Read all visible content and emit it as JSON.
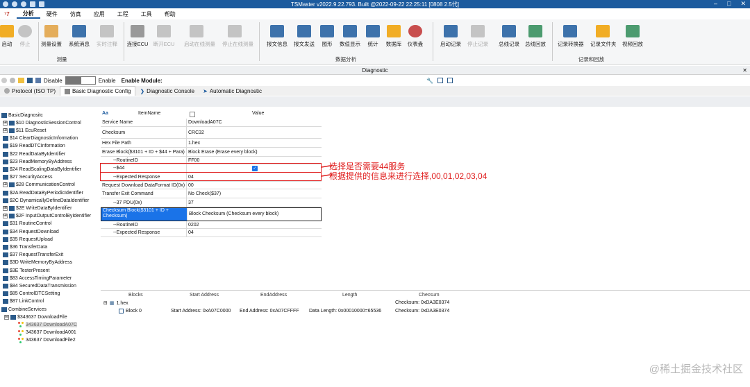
{
  "window": {
    "title": "TSMaster v2022.9.22.793. Built @2022-09-22 22:25:11 [0808 2.5代]"
  },
  "menu": {
    "items": [
      "分析",
      "硬件",
      "仿真",
      "应用",
      "工程",
      "工具",
      "帮助"
    ],
    "active": 0
  },
  "ribbon": {
    "buttons": [
      {
        "label": "启动",
        "icon": "lightning-icon",
        "color": "#f0a000",
        "dis": false
      },
      {
        "label": "停止",
        "icon": "stop-circle-icon",
        "color": "#bbb",
        "dis": true
      },
      {
        "label": "测量设置",
        "icon": "tree-settings-icon",
        "color": "#e0a040",
        "dis": false
      },
      {
        "label": "系统消息",
        "icon": "chat-icon",
        "color": "#1c5b9e",
        "dis": false
      },
      {
        "label": "实时注释",
        "icon": "comment-icon",
        "color": "#bbb",
        "dis": true
      },
      {
        "label": "连接ECU",
        "icon": "link-icon",
        "color": "#888",
        "dis": false
      },
      {
        "label": "断开ECU",
        "icon": "unlink-icon",
        "color": "#bbb",
        "dis": true
      },
      {
        "label": "启动在线测量",
        "icon": "play-icon",
        "color": "#bbb",
        "dis": true
      },
      {
        "label": "停止在线测量",
        "icon": "stop-square-icon",
        "color": "#bbb",
        "dis": true
      },
      {
        "label": "报文信息",
        "icon": "list-icon",
        "color": "#1c5b9e",
        "dis": false
      },
      {
        "label": "报文发送",
        "icon": "mail-icon",
        "color": "#1c5b9e",
        "dis": false
      },
      {
        "label": "图形",
        "icon": "line-graph-icon",
        "color": "#1c5b9e",
        "dis": false
      },
      {
        "label": "数值显示",
        "icon": "number-12-icon",
        "color": "#1c5b9e",
        "dis": false
      },
      {
        "label": "统计",
        "icon": "bar-stats-icon",
        "color": "#1c5b9e",
        "dis": false
      },
      {
        "label": "数据库",
        "icon": "database-icon",
        "color": "#f0a000",
        "dis": false
      },
      {
        "label": "仪表盘",
        "icon": "gauge-icon",
        "color": "#c03030",
        "dis": false
      },
      {
        "label": "启动记录",
        "icon": "record-play-icon",
        "color": "#1c5b9e",
        "dis": false
      },
      {
        "label": "停止记录",
        "icon": "record-stop-icon",
        "color": "#bbb",
        "dis": true
      },
      {
        "label": "总线记录",
        "icon": "bus-record-icon",
        "color": "#1c5b9e",
        "dis": false
      },
      {
        "label": "总线回放",
        "icon": "bus-replay-icon",
        "color": "#2e8b57",
        "dis": false
      },
      {
        "label": "记录转换器",
        "icon": "converter-icon",
        "color": "#1c5b9e",
        "dis": false
      },
      {
        "label": "记录文件夹",
        "icon": "folder-icon",
        "color": "#f0a000",
        "dis": false
      },
      {
        "label": "视频回放",
        "icon": "video-play-icon",
        "color": "#2e8b57",
        "dis": false
      }
    ],
    "groups": [
      "测量",
      "数据分析",
      "记录和回放"
    ]
  },
  "diagnostic": {
    "title": "Diagnostic",
    "close": "✕"
  },
  "toolbar": {
    "disable": "Disable",
    "enable": "Enable",
    "module": "Enable Module:"
  },
  "tabs": [
    "Protocol (ISO TP)",
    "Basic Diagnostic Config",
    "Diagnostic Console",
    "Automatic Diagnostic"
  ],
  "tree": {
    "root": "BasicDiagnositc",
    "items": [
      "$10 DiagnosticSessionControl",
      "$11 EcuReset",
      "$14 ClearDiagnosticInformation",
      "$19 ReadDTCInformation",
      "$22 ReadDataByIdentifier",
      "$23 ReadMemoryByAddress",
      "$24 ReadScalingDataByIdentifier",
      "$27 SecurityAccess",
      "$28 CommunicationControl",
      "$2A ReadDataByPeriodicIdentifier",
      "$2C DynamicallyDefineDataIdentifier",
      "$2E WriteDataByIdentifier",
      "$2F InputOutputControlByIdentifier",
      "$31 RoutineControl",
      "$34 RequestDownload",
      "$35 RequestUpload",
      "$36 TransferData",
      "$37 RequestTransferExit",
      "$3D WriteMemoryByAddress",
      "$3E TesterPresent",
      "$83 AccessTimingParameter",
      "$84 SecuredDataTransmission",
      "$85 ControlDTCSetting",
      "$87 LinkControl"
    ],
    "combine": "CombineServices",
    "download_file": "$343637 DownloadFile",
    "downloads": [
      "343637 DownloadA07C",
      "343637 DownloadA001",
      "343637 DownloadFile2"
    ]
  },
  "grid": {
    "headers": [
      "Aa",
      "ItemName",
      "Value"
    ],
    "rows": [
      {
        "name": "Service Name",
        "value": "DownloadA07C"
      },
      {
        "name": "Checksum",
        "value": "CRC32"
      },
      {
        "name": "Hex File Path",
        "value": "1.hex"
      },
      {
        "name": "Erase Block($3101 + ID + $44 + Para)",
        "value": "Block Erase (Erase every block)"
      },
      {
        "name": "--RoutineID",
        "value": "FF00"
      },
      {
        "name": "--$44",
        "value": ""
      },
      {
        "name": "--Expected Response",
        "value": "04"
      },
      {
        "name": "Request Download DataFormat ID(0x)",
        "value": "00"
      },
      {
        "name": "Transfer Exit Command",
        "value": "No Check($37)"
      },
      {
        "name": "--37 PDU(0x)",
        "value": "37"
      },
      {
        "name": "Checksum Block($3101 + ID + Checksum)",
        "value": "Block Checksum (Checksum every block)"
      },
      {
        "name": "--RoutineID",
        "value": "0202"
      },
      {
        "name": "--Expected Response",
        "value": "04"
      }
    ]
  },
  "annotation": {
    "line1": "选择是否需要44服务",
    "line2": "根据提供的信息来进行选择,00,01,02,03,04"
  },
  "blocks": {
    "headers": [
      "Blocks",
      "Start Address",
      "EndAddress",
      "Length",
      "Checsum"
    ],
    "file": "1.hex",
    "file_checksum": "Checksum: 0xDA3E0374",
    "block": {
      "name": "Block 0",
      "start": "Start Address: 0xA07C0000",
      "end": "End Address: 0xA07CFFFF",
      "length": "Data Length: 0x00010000=65536",
      "checksum": "Checksum: 0xDA3E0374"
    }
  },
  "watermark": "@稀土掘金技术社区"
}
